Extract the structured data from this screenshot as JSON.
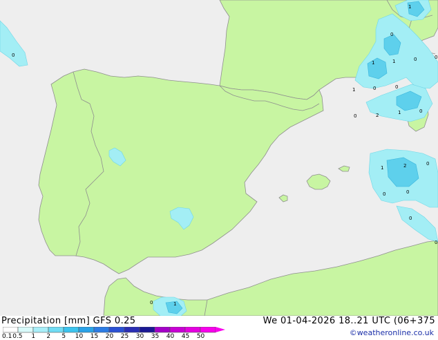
{
  "map": {
    "region": "Iberian Peninsula",
    "colors": {
      "sea": "#eeeeee",
      "land": "#c8f5a2",
      "border": "#8e8e8e"
    },
    "point_values": [
      {
        "id": "sea-top-left",
        "text": "0"
      },
      {
        "id": "fr-ne",
        "text": "1"
      },
      {
        "id": "gulf-lion-a",
        "text": "0"
      },
      {
        "id": "gulf-lion-b",
        "text": "1"
      },
      {
        "id": "gulf-lion-c",
        "text": "1"
      },
      {
        "id": "ligurian-a",
        "text": "0"
      },
      {
        "id": "edge-right-a",
        "text": "0"
      },
      {
        "id": "catalonia-a",
        "text": "1"
      },
      {
        "id": "catalonia-b",
        "text": "0"
      },
      {
        "id": "catalonia-c",
        "text": "0"
      },
      {
        "id": "balearic-a",
        "text": "0"
      },
      {
        "id": "balearic-b",
        "text": "2"
      },
      {
        "id": "balearic-c",
        "text": "1"
      },
      {
        "id": "sardinia-a",
        "text": "0"
      },
      {
        "id": "south-a",
        "text": "1"
      },
      {
        "id": "south-b",
        "text": "2"
      },
      {
        "id": "edge-right-b",
        "text": "0"
      },
      {
        "id": "south-c",
        "text": "0"
      },
      {
        "id": "south-d",
        "text": "0"
      },
      {
        "id": "south-e",
        "text": "0"
      },
      {
        "id": "algeria-edge",
        "text": "0"
      },
      {
        "id": "morocco-a",
        "text": "0"
      },
      {
        "id": "morocco-b",
        "text": "1"
      }
    ]
  },
  "footer": {
    "title": "Precipitation [mm]  GFS 0.25",
    "run_info": "We 01-04-2026 18..21 UTC (06+375",
    "credit": "©weatheronline.co.uk"
  },
  "legend": {
    "ticks": [
      "0.1",
      "0.5",
      "1",
      "2",
      "5",
      "10",
      "15",
      "20",
      "25",
      "30",
      "35",
      "40",
      "45",
      "50"
    ],
    "colors": [
      "#ffffff",
      "#d8fafa",
      "#a8eef8",
      "#70dcf4",
      "#3cc4ee",
      "#2aa2e8",
      "#2c7ce4",
      "#2a50d4",
      "#2a2eb4",
      "#1a1894",
      "#a400c8",
      "#c800d4",
      "#e400e0",
      "#f800ec"
    ]
  }
}
